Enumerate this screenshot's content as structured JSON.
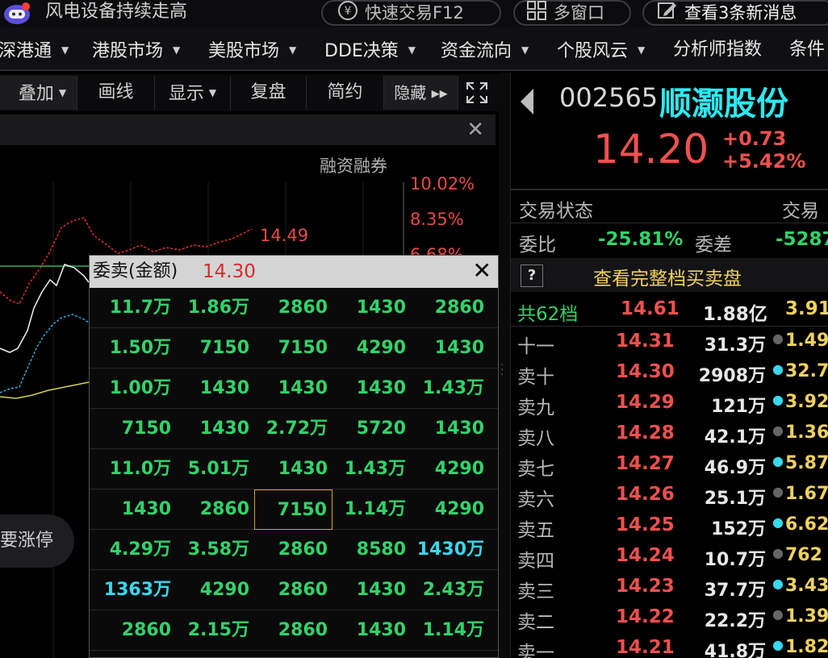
{
  "topbar": {
    "news_title": "风电设备持续走高",
    "trade_label": "快速交易F12",
    "multi_label": "多窗口",
    "news_label": "查看3条新消息"
  },
  "nav": {
    "items": [
      {
        "label": "深港通",
        "caret": "▼"
      },
      {
        "label": "港股市场",
        "caret": "▼"
      },
      {
        "label": "美股市场",
        "caret": "▼"
      },
      {
        "label": "DDE决策",
        "caret": "▼"
      },
      {
        "label": "资金流向",
        "caret": "▼"
      },
      {
        "label": "个股风云",
        "caret": "▼"
      },
      {
        "label": "分析师指数",
        "caret": ""
      },
      {
        "label": "条件",
        "caret": ""
      }
    ]
  },
  "toolbar": {
    "overlay": "叠加",
    "draw": "画线",
    "display": "显示",
    "replay": "复盘",
    "simple": "简约",
    "hide": "隐藏 ▸▸",
    "close": "✕"
  },
  "chart": {
    "margin_label": "融资融券",
    "pct_labels": [
      "10.02%",
      "8.35%",
      "6.68%"
    ],
    "price_label": "14.49",
    "limit_label": "要涨停"
  },
  "popup": {
    "title": "委卖(金额)",
    "price": "14.30",
    "close": "✕",
    "rows": [
      [
        "11.7万",
        "1.86万",
        "2860",
        "1430",
        "2860"
      ],
      [
        "1.50万",
        "7150",
        "7150",
        "4290",
        "1430"
      ],
      [
        "1.00万",
        "1430",
        "1430",
        "1430",
        "1.43万"
      ],
      [
        "7150",
        "1430",
        "2.72万",
        "5720",
        "1430"
      ],
      [
        "11.0万",
        "5.01万",
        "1430",
        "1.43万",
        "4290"
      ],
      [
        "1430",
        "2860",
        "7150",
        "1.14万",
        "4290"
      ],
      [
        "4.29万",
        "3.58万",
        "2860",
        "8580",
        "1430万"
      ],
      [
        "1363万",
        "4290",
        "2860",
        "1430",
        "2.43万"
      ],
      [
        "2860",
        "2.15万",
        "2860",
        "1430",
        "1.14万"
      ]
    ],
    "highlight": {
      "cyan": [
        [
          6,
          4
        ],
        [
          7,
          0
        ]
      ],
      "selected": [
        5,
        2
      ]
    }
  },
  "stock": {
    "code": "002565",
    "name": "顺灏股份",
    "price": "14.20",
    "change": "+0.73",
    "change_pct": "+5.42%"
  },
  "status": {
    "trade_status_label": "交易状态",
    "trade_label": "交易",
    "weibi_label": "委比",
    "weibi_value": "-25.81%",
    "weicha_label": "委差",
    "weicha_value": "-5287",
    "view_full_label": "查看完整档买卖盘",
    "help": "?"
  },
  "book": {
    "total_label": "共62档",
    "total_price": "14.61",
    "total_amount": "1.88亿",
    "total_ext": "3.91",
    "levels": [
      {
        "label": "十一",
        "price": "14.31",
        "vol": "31.3万",
        "dot": "grey",
        "ext": "1.49"
      },
      {
        "label": "卖十",
        "price": "14.30",
        "vol": "2908万",
        "dot": "cyan",
        "ext": "32.7"
      },
      {
        "label": "卖九",
        "price": "14.29",
        "vol": "121万",
        "dot": "cyan",
        "ext": "3.92"
      },
      {
        "label": "卖八",
        "price": "14.28",
        "vol": "42.1万",
        "dot": "grey",
        "ext": "1.36"
      },
      {
        "label": "卖七",
        "price": "14.27",
        "vol": "46.9万",
        "dot": "cyan",
        "ext": "5.87"
      },
      {
        "label": "卖六",
        "price": "14.26",
        "vol": "25.1万",
        "dot": "grey",
        "ext": "1.67"
      },
      {
        "label": "卖五",
        "price": "14.25",
        "vol": "152万",
        "dot": "cyan",
        "ext": "6.62"
      },
      {
        "label": "卖四",
        "price": "14.24",
        "vol": "10.7万",
        "dot": "grey",
        "ext": "762"
      },
      {
        "label": "卖三",
        "price": "14.23",
        "vol": "37.7万",
        "dot": "cyan",
        "ext": "3.43"
      },
      {
        "label": "卖二",
        "price": "14.22",
        "vol": "22.2万",
        "dot": "grey",
        "ext": "1.39"
      },
      {
        "label": "卖一",
        "price": "14.21",
        "vol": "41.8万",
        "dot": "cyan",
        "ext": "1.82"
      }
    ]
  },
  "colors": {
    "up": "#f05050",
    "down": "#32d26a",
    "cyan": "#38d8ee",
    "yellow": "#f0d060"
  }
}
